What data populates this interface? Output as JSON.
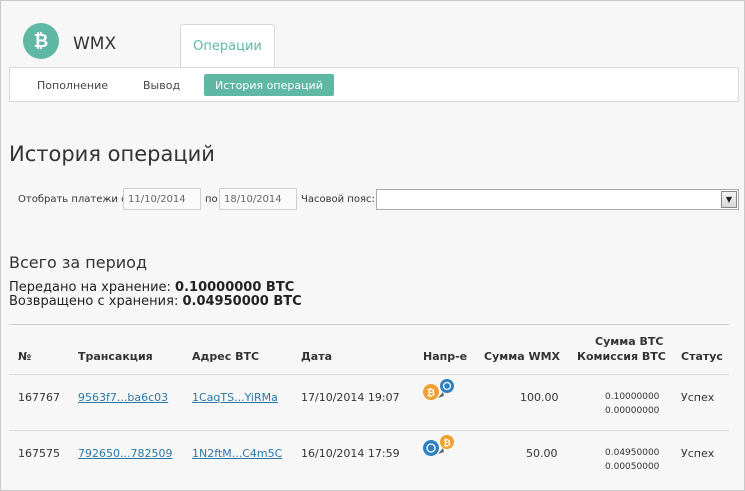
{
  "header": {
    "brand": "WMX",
    "top_tab": "Операции"
  },
  "subnav": {
    "items": [
      {
        "label": "Пополнение"
      },
      {
        "label": "Вывод"
      },
      {
        "label": "История операций"
      }
    ]
  },
  "page": {
    "title": "История операций"
  },
  "filter": {
    "show_label": "Отобрать платежи с",
    "from_value": "11/10/2014",
    "to_label": "по",
    "to_value": "18/10/2014",
    "tz_label": "Часовой пояс:"
  },
  "summary": {
    "title": "Всего за период",
    "deposited_label": "Передано на хранение:",
    "deposited_value": "0.10000000 BTC",
    "returned_label": "Возвращено с хранения:",
    "returned_value": "0.04950000 BTC"
  },
  "table": {
    "headers": {
      "num": "№",
      "tx": "Трансакция",
      "address": "Адрес BTC",
      "date": "Дата",
      "direction": "Напр-е",
      "wmx": "Сумма WMX",
      "btc_line1": "Сумма BTC",
      "btc_line2": "Комиссия BTC",
      "status": "Статус"
    },
    "rows": [
      {
        "num": "167767",
        "tx": "9563f7...ba6c03",
        "address": "1CaqTS...YiRMa",
        "date": "17/10/2014 19:07",
        "direction": "btc-to-wm",
        "wmx": "100.00",
        "btc": "0.10000000",
        "fee": "0.00000000",
        "status": "Успех"
      },
      {
        "num": "167575",
        "tx": "792650...782509",
        "address": "1N2ftM...C4m5C",
        "date": "16/10/2014 17:59",
        "direction": "wm-to-btc",
        "wmx": "50.00",
        "btc": "0.04950000",
        "fee": "0.00050000",
        "status": "Успех"
      }
    ]
  },
  "colors": {
    "accent": "#5fb8a4",
    "link": "#2a77a8",
    "bitcoin": "#f0a030",
    "webmoney": "#2f7fc1"
  }
}
